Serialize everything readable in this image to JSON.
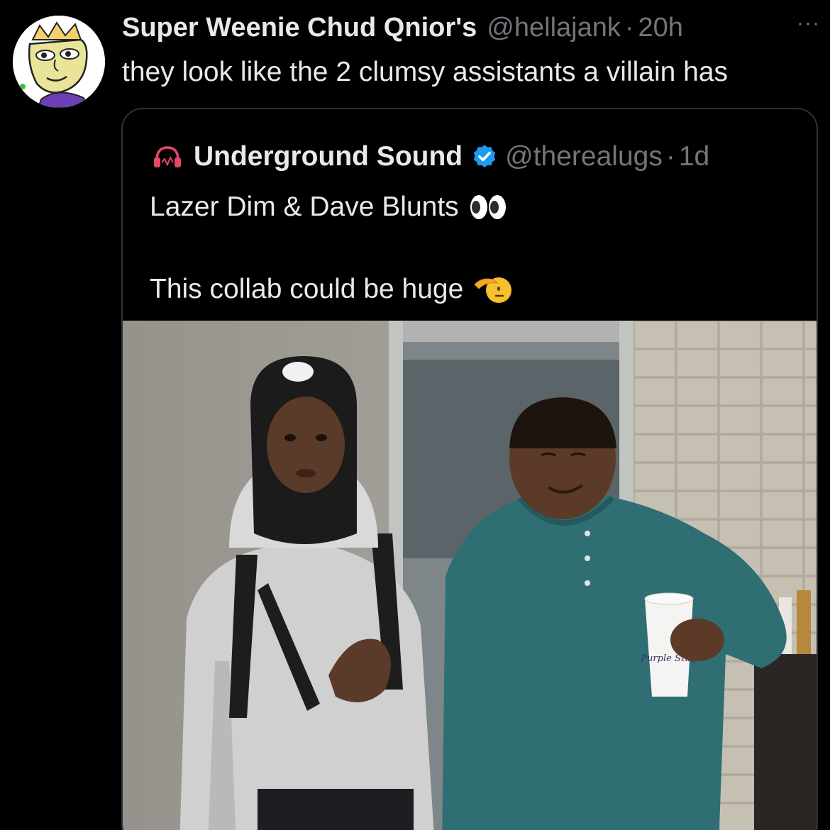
{
  "tweet": {
    "display_name": "Super Weenie Chud Qnior's",
    "handle": "@hellajank",
    "separator": "·",
    "time": "20h",
    "more_label": "···",
    "text": "they look like the 2 clumsy assistants a villain has"
  },
  "quoted_tweet": {
    "display_name": "Underground Sound",
    "handle": "@therealugs",
    "separator": "·",
    "time": "1d",
    "verified": true,
    "line1": "Lazer Dim & Dave Blunts",
    "line2": "This collab could be huge",
    "line1_emoji": "eyes-emoji",
    "line2_emoji": "saluting-face-emoji",
    "avatar_icon": "headphones-icon"
  },
  "photo": {
    "cup_text": "Purple Stuff"
  },
  "colors": {
    "background": "#000000",
    "text_primary": "#e7e9ea",
    "text_secondary": "#71767b",
    "border": "#2f3336",
    "verified_blue": "#1d9bf0",
    "headphones_pink": "#e8456b"
  }
}
